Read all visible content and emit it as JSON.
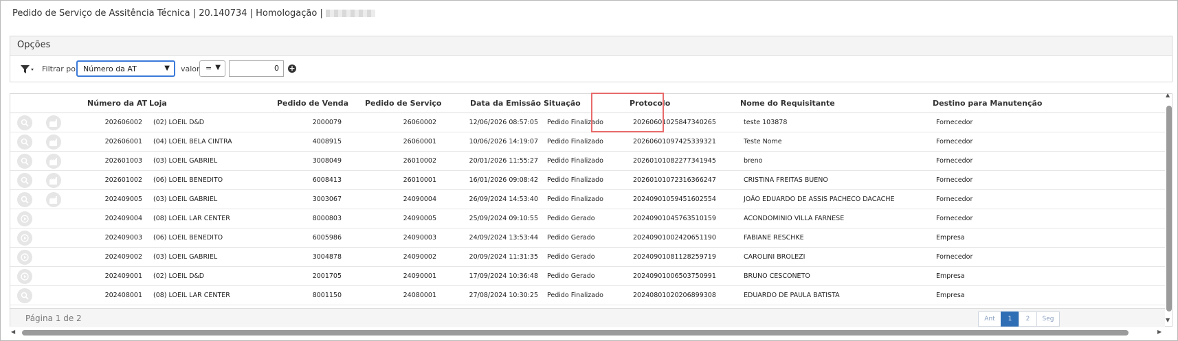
{
  "header": {
    "title": "Pedido de Serviço de Assitência Técnica | 20.140734 | Homologação |"
  },
  "options": {
    "panel_title": "Opções",
    "filter_label": "Filtrar por",
    "filter_field": "Número da AT",
    "value_label": "valor",
    "operator": "=",
    "value": "0"
  },
  "grid": {
    "columns": [
      "Número da AT",
      "Loja",
      "Pedido de Venda",
      "Pedido de Serviço",
      "Data da Emissão",
      "Situação",
      "Protocolo",
      "Nome do Requisitante",
      "Destino para Manutenção"
    ],
    "rows": [
      {
        "numero": "202606002",
        "loja": "(02) LOEIL D&D",
        "pedido_venda": "2000079",
        "pedido_servico": "26060002",
        "data": "12/06/2026 08:57:05",
        "situacao": "Pedido Finalizado",
        "protocolo": "20260601025847340265",
        "requisitante": "teste 103878",
        "destino": "Fornecedor",
        "icons": "search-factory"
      },
      {
        "numero": "202606001",
        "loja": "(04) LOEIL BELA CINTRA",
        "pedido_venda": "4008915",
        "pedido_servico": "26060001",
        "data": "10/06/2026 14:19:07",
        "situacao": "Pedido Finalizado",
        "protocolo": "20260601097425339321",
        "requisitante": "Teste Nome",
        "destino": "Fornecedor",
        "icons": "search-factory"
      },
      {
        "numero": "202601003",
        "loja": "(03) LOEIL GABRIEL",
        "pedido_venda": "3008049",
        "pedido_servico": "26010002",
        "data": "20/01/2026 11:55:27",
        "situacao": "Pedido Finalizado",
        "protocolo": "20260101082277341945",
        "requisitante": "breno",
        "destino": "Fornecedor",
        "icons": "search-factory"
      },
      {
        "numero": "202601002",
        "loja": "(06) LOEIL BENEDITO",
        "pedido_venda": "6008413",
        "pedido_servico": "26010001",
        "data": "16/01/2026 09:08:42",
        "situacao": "Pedido Finalizado",
        "protocolo": "20260101072316366247",
        "requisitante": "CRISTINA FREITAS BUENO",
        "destino": "Fornecedor",
        "icons": "search-factory"
      },
      {
        "numero": "202409005",
        "loja": "(03) LOEIL GABRIEL",
        "pedido_venda": "3003067",
        "pedido_servico": "24090004",
        "data": "26/09/2024 14:53:40",
        "situacao": "Pedido Finalizado",
        "protocolo": "20240901059451602554",
        "requisitante": "JOÃO EDUARDO DE ASSIS PACHECO DACACHE",
        "destino": "Fornecedor",
        "icons": "search-factory"
      },
      {
        "numero": "202409004",
        "loja": "(08) LOEIL LAR CENTER",
        "pedido_venda": "8000803",
        "pedido_servico": "24090005",
        "data": "25/09/2024 09:10:55",
        "situacao": "Pedido Gerado",
        "protocolo": "20240901045763510159",
        "requisitante": "ACONDOMINIO VILLA FARNESE",
        "destino": "Fornecedor",
        "icons": "play"
      },
      {
        "numero": "202409003",
        "loja": "(06) LOEIL BENEDITO",
        "pedido_venda": "6005986",
        "pedido_servico": "24090003",
        "data": "24/09/2024 13:53:44",
        "situacao": "Pedido Gerado",
        "protocolo": "20240901002420651190",
        "requisitante": "FABIANE RESCHKE",
        "destino": "Empresa",
        "icons": "play"
      },
      {
        "numero": "202409002",
        "loja": "(03) LOEIL GABRIEL",
        "pedido_venda": "3004878",
        "pedido_servico": "24090002",
        "data": "20/09/2024 11:31:35",
        "situacao": "Pedido Gerado",
        "protocolo": "20240901081128259719",
        "requisitante": "CAROLINI BROLEZI",
        "destino": "Fornecedor",
        "icons": "play"
      },
      {
        "numero": "202409001",
        "loja": "(02) LOEIL D&D",
        "pedido_venda": "2001705",
        "pedido_servico": "24090001",
        "data": "17/09/2024 10:36:48",
        "situacao": "Pedido Gerado",
        "protocolo": "20240901006503750991",
        "requisitante": "BRUNO CESCONETO",
        "destino": "Empresa",
        "icons": "play"
      },
      {
        "numero": "202408001",
        "loja": "(08) LOEIL LAR CENTER",
        "pedido_venda": "8001150",
        "pedido_servico": "24080001",
        "data": "27/08/2024 10:30:25",
        "situacao": "Pedido Finalizado",
        "protocolo": "20240801020206899308",
        "requisitante": "EDUARDO DE PAULA BATISTA",
        "destino": "Empresa",
        "icons": "search"
      }
    ]
  },
  "pager": {
    "info": "Página 1 de 2",
    "prev": "Ant",
    "pages": [
      "1",
      "2"
    ],
    "next": "Seg"
  },
  "colors": {
    "highlight": "#e86a6a",
    "active_page": "#2f6db5"
  }
}
